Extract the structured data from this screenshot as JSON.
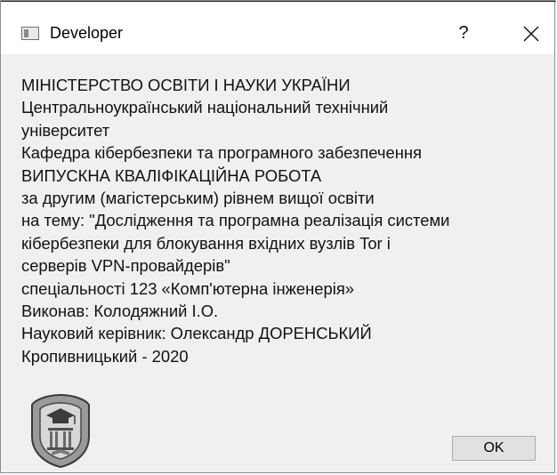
{
  "window": {
    "title": "Developer",
    "help_label": "?",
    "icon": "window-app-icon",
    "close_icon": "close-icon"
  },
  "message": {
    "lines": [
      "МІНІСТЕРСТВО ОСВІТИ І НАУКИ УКРАЇНИ",
      "Центральноукраїнський національний технічний",
      "університет",
      "Кафедра кібербезпеки та програмного забезпечення",
      "ВИПУСКНА КВАЛІФІКАЦІЙНА РОБОТА",
      "за другим (магістерським) рівнем вищої освіти",
      "на тему: \"Дослідження та програмна реалізація системи",
      "кібербезпеки для  блокування вхідних вузлів Tor і",
      "серверів VPN-провайдерів\"",
      "спеціальності 123 «Комп'ютерна інженерія»",
      "Виконав: Колодяжний І.О.",
      "Науковий керівник: Олександр ДОРЕНСЬКИЙ",
      "Кропивницький - 2020"
    ]
  },
  "emblem": {
    "icon": "university-emblem-icon"
  },
  "buttons": {
    "ok_label": "OK"
  }
}
